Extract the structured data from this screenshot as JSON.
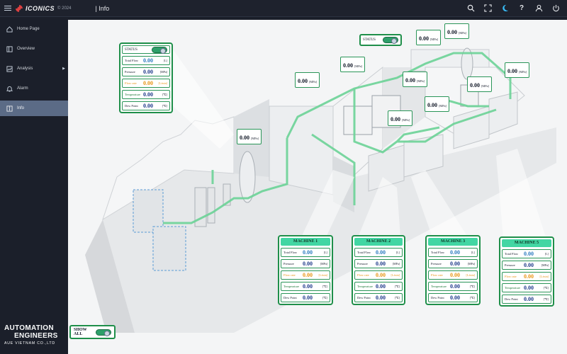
{
  "header": {
    "brand": "ICONICS",
    "year": "© 2024",
    "title": "| Info",
    "icons": [
      "search-icon",
      "fullscreen-icon",
      "moon-icon",
      "help-icon",
      "user-icon",
      "power-icon"
    ]
  },
  "sidebar": {
    "items": [
      {
        "label": "Home Page",
        "icon": "home-icon"
      },
      {
        "label": "Overview",
        "icon": "overview-icon"
      },
      {
        "label": "Analysis",
        "icon": "analysis-icon"
      },
      {
        "label": "Alarm",
        "icon": "bell-icon"
      },
      {
        "label": "Info",
        "icon": "info-icon"
      }
    ],
    "active": "Info",
    "logo": {
      "line1": "AUTOMATION",
      "line2": "ENGINEERS",
      "line3": "AUE VIETNAM CO.,LTD"
    }
  },
  "labels": {
    "status": "STATUS",
    "total_flow": "Total Flow",
    "pressure": "Pressure",
    "flow_rate": "Flow rate",
    "temperature": "Temperature",
    "dew_point": "Dew Point",
    "show_all": "SHOW ALL"
  },
  "units": {
    "total_flow": "[L]",
    "pressure": "[MPa]",
    "flow_rate": "[L/min]",
    "temperature": "[℃]",
    "dew_point": "[℃]"
  },
  "main_panel": {
    "total_flow": "0.00",
    "pressure": "0.00",
    "flow_rate": "0.00",
    "temperature": "0.00",
    "dew_point": "0.00"
  },
  "machines": [
    {
      "title": "MACHINE 1",
      "total_flow": "0.00",
      "pressure": "0.00",
      "flow_rate": "0.00",
      "temperature": "0.00",
      "dew_point": "0.00"
    },
    {
      "title": "MACHINE 2",
      "total_flow": "0.00",
      "pressure": "0.00",
      "flow_rate": "0.00",
      "temperature": "0.00",
      "dew_point": "0.00"
    },
    {
      "title": "MACHINE 3",
      "total_flow": "0.00",
      "pressure": "0.00",
      "flow_rate": "0.00",
      "temperature": "0.00",
      "dew_point": "0.00"
    },
    {
      "title": "MACHINE 5",
      "total_flow": "0.00",
      "pressure": "0.00",
      "flow_rate": "0.00",
      "temperature": "0.00",
      "dew_point": "0.00"
    }
  ],
  "pressure_readouts": [
    {
      "value": "0.00",
      "unit": "[MPa]"
    },
    {
      "value": "0.00",
      "unit": "[MPa]"
    },
    {
      "value": "0.00",
      "unit": "[MPa]"
    },
    {
      "value": "0.00",
      "unit": "[MPa]"
    },
    {
      "value": "0.00",
      "unit": "[MPa]"
    },
    {
      "value": "0.00",
      "unit": "[MPa]"
    },
    {
      "value": "0.00",
      "unit": "[MPa]"
    },
    {
      "value": "0.00",
      "unit": "[MPa]"
    },
    {
      "value": "0.00",
      "unit": "[MPa]"
    },
    {
      "value": "0.00",
      "unit": "[MPa]"
    }
  ],
  "colors": {
    "accent": "#1f8f4a",
    "header_bg": "#42d6a3",
    "flow_rate": "#e89516",
    "value_blue": "#2b7bbf",
    "value_navy": "#1e3a8a"
  }
}
